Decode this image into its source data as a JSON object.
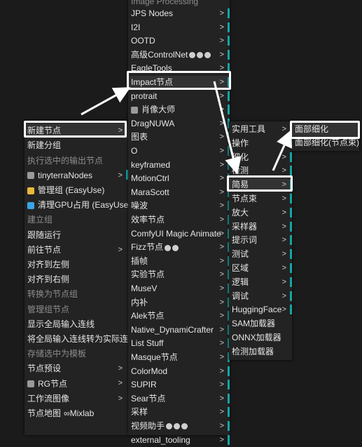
{
  "main_menu": {
    "items": [
      {
        "label": "新建节点",
        "submenu": true,
        "highlight": true
      },
      {
        "label": "新建分组"
      },
      {
        "label": "执行选中的输出节点",
        "disabled": true
      },
      {
        "label": "tinyterraNodes",
        "submenu": true,
        "icon": "tinyterra-icon",
        "bar": true
      },
      {
        "label": "管理组 (EasyUse)",
        "icon": "easyuse-group-icon"
      },
      {
        "label": "清理GPU占用 (EasyUse)",
        "icon": "broom-icon"
      },
      {
        "label": "建立组",
        "disabled": true
      },
      {
        "label": "跟随运行"
      },
      {
        "label": "前往节点",
        "submenu": true
      },
      {
        "label": "对齐到左侧"
      },
      {
        "label": "对齐到右侧"
      },
      {
        "label": "转换为节点组",
        "disabled": true
      },
      {
        "label": "管理组节点",
        "disabled": true
      },
      {
        "label": "显示全局输入连线"
      },
      {
        "label": "将全局输入连线转为实际连线"
      },
      {
        "label": "存储选中为模板",
        "disabled": true
      },
      {
        "label": "节点预设",
        "submenu": true
      },
      {
        "label": "RG节点",
        "submenu": true,
        "icon": "rg-logo-icon"
      },
      {
        "label": "工作流图像",
        "submenu": true
      },
      {
        "label": "节点地图",
        "suffix": "∞Mixlab"
      }
    ]
  },
  "category_menu": {
    "top_partial": "Image Processing",
    "items": [
      {
        "label": "JPS Nodes"
      },
      {
        "label": "I2I"
      },
      {
        "label": "OOTD"
      },
      {
        "label": "高级ControlNet",
        "badges": 3
      },
      {
        "label": "EagleTools"
      },
      {
        "label": "Impact节点",
        "highlight": true
      },
      {
        "label": "protrait"
      },
      {
        "label": "肖像大师",
        "icon": "portrait-master-icon"
      },
      {
        "label": "DragNUWA"
      },
      {
        "label": "图表"
      },
      {
        "label": "O"
      },
      {
        "label": "keyframed"
      },
      {
        "label": "MotionCtrl"
      },
      {
        "label": "MaraScott"
      },
      {
        "label": "噪波"
      },
      {
        "label": "效率节点"
      },
      {
        "label": "ComfyUI Magic Animate"
      },
      {
        "label": "Fizz节点",
        "badges": 2
      },
      {
        "label": "插帧"
      },
      {
        "label": "实验节点"
      },
      {
        "label": "MuseV"
      },
      {
        "label": "内补"
      },
      {
        "label": "Alek节点"
      },
      {
        "label": "Native_DynamiCrafter"
      },
      {
        "label": "List Stuff"
      },
      {
        "label": "Masque节点"
      },
      {
        "label": "ColorMod"
      },
      {
        "label": "SUPIR"
      },
      {
        "label": "Sear节点"
      },
      {
        "label": "采样"
      },
      {
        "label": "视频助手",
        "badges": 3
      },
      {
        "label": "external_tooling"
      }
    ]
  },
  "impact_menu": {
    "items": [
      {
        "label": "实用工具"
      },
      {
        "label": "操作"
      },
      {
        "label": "细化"
      },
      {
        "label": "检测"
      },
      {
        "label": "简易",
        "highlight": true
      },
      {
        "label": "节点束"
      },
      {
        "label": "放大"
      },
      {
        "label": "采样器"
      },
      {
        "label": "提示词"
      },
      {
        "label": "测试"
      },
      {
        "label": "区域"
      },
      {
        "label": "逻辑"
      },
      {
        "label": "调试"
      },
      {
        "label": "HuggingFace"
      },
      {
        "label": "SAM加载器",
        "nosub": true
      },
      {
        "label": "ONNX加载器",
        "nosub": true
      },
      {
        "label": "检测加载器",
        "nosub": true
      }
    ]
  },
  "easy_menu": {
    "items": [
      {
        "label": "面部细化",
        "highlight": true
      },
      {
        "label": "面部细化(节点束)"
      }
    ]
  },
  "colors": {
    "accent_bar": "#15a5a5",
    "annotation": "#ffffff",
    "menu_bg": "#232323",
    "highlight_bg": "#323232"
  }
}
